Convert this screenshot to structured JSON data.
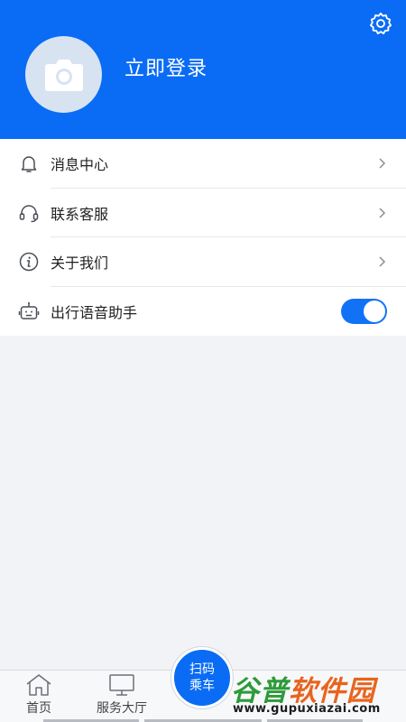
{
  "header": {
    "login_label": "立即登录",
    "accent_color": "#0a6cf5",
    "settings_icon": "gear-icon",
    "avatar_icon": "camera-icon"
  },
  "menu": {
    "items": [
      {
        "icon": "bell-icon",
        "label": "消息中心",
        "trailing": "chevron-right-icon"
      },
      {
        "icon": "headset-icon",
        "label": "联系客服",
        "trailing": "chevron-right-icon"
      },
      {
        "icon": "info-icon",
        "label": "关于我们",
        "trailing": "chevron-right-icon"
      },
      {
        "icon": "robot-icon",
        "label": "出行语音助手",
        "trailing": "toggle",
        "toggle_on": true
      }
    ]
  },
  "tabbar": {
    "tabs": [
      {
        "icon": "home-icon",
        "label": "首页"
      },
      {
        "icon": "monitor-icon",
        "label": "服务大厅"
      }
    ],
    "scan_button": {
      "line1": "扫码",
      "line2": "乘车"
    }
  },
  "watermark": {
    "title": "谷普软件园",
    "url": "www.gupuxiazai.com"
  }
}
